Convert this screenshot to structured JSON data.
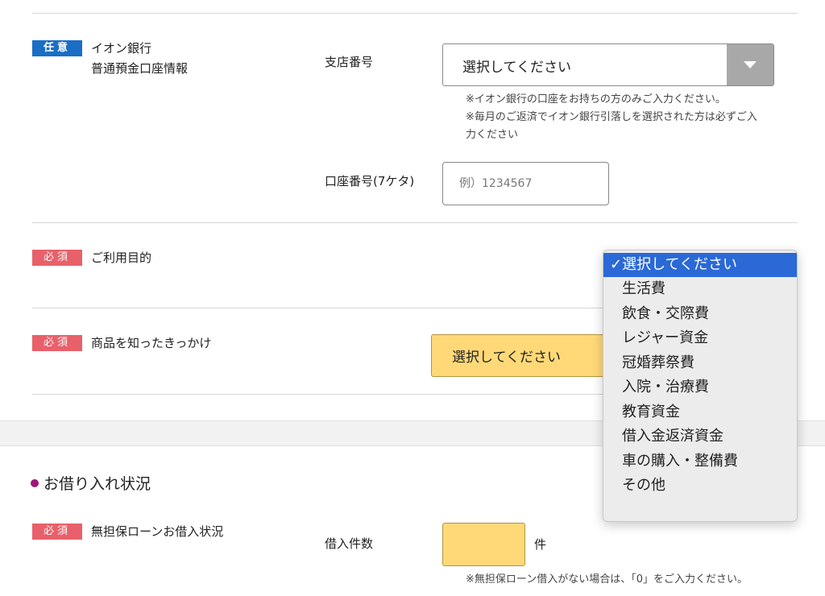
{
  "aeon_account": {
    "badge": "任意",
    "title_line1": "イオン銀行",
    "title_line2": "普通預金口座情報",
    "branch_label": "支店番号",
    "branch_select_value": "選択してください",
    "note1": "※イオン銀行の口座をお持ちの方のみご入力ください。",
    "note2_line1": "※毎月のご返済でイオン銀行引落しを選択された方は必ずご入",
    "note2_line2": "力ください",
    "account_label": "口座番号(7ケタ)",
    "account_placeholder": "例）1234567"
  },
  "purpose": {
    "badge": "必須",
    "title": "ご利用目的",
    "menu_items": [
      "✓選択してください",
      "生活費",
      "飲食・交際費",
      "レジャー資金",
      "冠婚葬祭費",
      "入院・治療費",
      "教育資金",
      "借入金返済資金",
      "車の購入・整備費",
      "その他"
    ]
  },
  "trigger": {
    "badge": "必須",
    "title": "商品を知ったきっかけ",
    "select_value": "選択してください"
  },
  "borrowing": {
    "heading": "お借り入れ状況",
    "badge": "必須",
    "title": "無担保ローンお借入状況",
    "count_label": "借入件数",
    "unit": "件",
    "note": "※無担保ローン借入がない場合は、「0」をご入力ください。"
  },
  "colors": {
    "optional_badge": "#1a6ec4",
    "required_badge": "#e8606a",
    "required_field": "#ffd978",
    "menu_highlight": "#2a69d6",
    "heading_dot": "#a0157a"
  }
}
